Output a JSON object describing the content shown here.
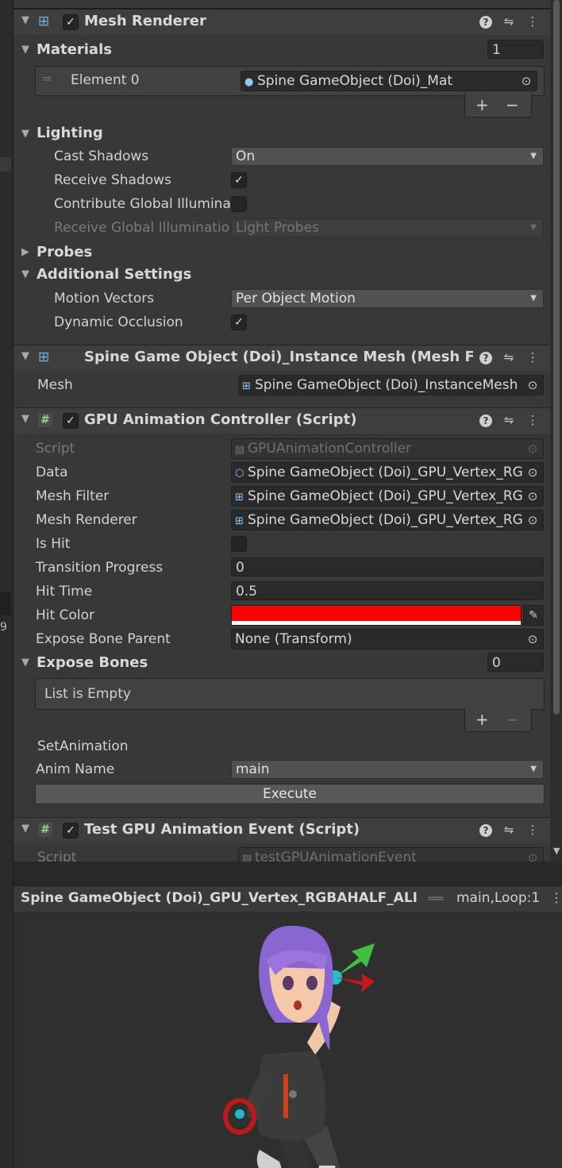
{
  "mesh_renderer": {
    "title": "Mesh Renderer",
    "enabled": true,
    "materials": {
      "label": "Materials",
      "count": "1",
      "elements": [
        {
          "label": "Element 0",
          "value": "Spine GameObject (Doi)_Mat"
        }
      ]
    },
    "lighting": {
      "label": "Lighting",
      "cast_shadows_label": "Cast Shadows",
      "cast_shadows_value": "On",
      "receive_shadows_label": "Receive Shadows",
      "receive_shadows": true,
      "contribute_gi_label": "Contribute Global Illumina",
      "contribute_gi": false,
      "receive_gi_label": "Receive Global Illuminatio",
      "receive_gi_value": "Light Probes"
    },
    "probes_label": "Probes",
    "additional_settings": {
      "label": "Additional Settings",
      "motion_vectors_label": "Motion Vectors",
      "motion_vectors_value": "Per Object Motion",
      "dynamic_occlusion_label": "Dynamic Occlusion",
      "dynamic_occlusion": true
    }
  },
  "mesh_filter": {
    "title": "Spine Game Object (Doi)_Instance Mesh (Mesh Filt",
    "mesh_label": "Mesh",
    "mesh_value": "Spine GameObject (Doi)_InstanceMesh"
  },
  "gpu_controller": {
    "title": "GPU Animation Controller (Script)",
    "enabled": true,
    "script_label": "Script",
    "script_value": "GPUAnimationController",
    "data_label": "Data",
    "data_value": "Spine GameObject (Doi)_GPU_Vertex_RG",
    "mesh_filter_label": "Mesh Filter",
    "mesh_filter_value": "Spine GameObject (Doi)_GPU_Vertex_RG",
    "mesh_renderer_label": "Mesh Renderer",
    "mesh_renderer_value": "Spine GameObject (Doi)_GPU_Vertex_RG",
    "is_hit_label": "Is Hit",
    "is_hit": false,
    "transition_label": "Transition Progress",
    "transition_value": "0",
    "hit_time_label": "Hit Time",
    "hit_time_value": "0.5",
    "hit_color_label": "Hit Color",
    "hit_color": "#ff0000",
    "expose_parent_label": "Expose Bone Parent",
    "expose_parent_value": "None (Transform)",
    "expose_bones_label": "Expose Bones",
    "expose_bones_count": "0",
    "list_empty": "List is Empty",
    "set_animation_label": "SetAnimation",
    "anim_name_label": "Anim Name",
    "anim_name_value": "main",
    "execute_label": "Execute"
  },
  "test_event": {
    "title": "Test GPU Animation Event (Script)",
    "enabled": true,
    "script_label": "Script",
    "script_value": "testGPUAnimationEvent"
  },
  "preview": {
    "title": "Spine GameObject (Doi)_GPU_Vertex_RGBAHALF_ALI",
    "status": "main,Loop:1"
  },
  "icons": {
    "help": "?",
    "settings": "⇋",
    "more": "⋮",
    "plus": "+",
    "minus": "−"
  }
}
